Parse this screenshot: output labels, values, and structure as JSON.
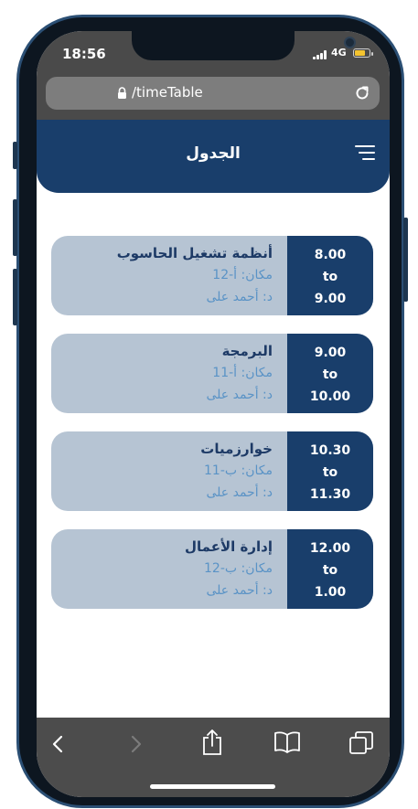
{
  "status_bar": {
    "time": "18:56",
    "network": "4G",
    "icons": [
      "signal-bars-icon",
      "battery-icon"
    ]
  },
  "browser": {
    "url": "/timeTable",
    "icons": [
      "lock-icon",
      "reload-icon"
    ]
  },
  "header": {
    "title": "الجدول",
    "menu_icon": "hamburger-menu-icon"
  },
  "schedule": [
    {
      "start": "8.00",
      "separator": "to",
      "end": "9.00",
      "course": "أنظمة تشغيل الحاسوب",
      "room": "مكان: أ-12",
      "teacher": "د: أحمد على"
    },
    {
      "start": "9.00",
      "separator": "to",
      "end": "10.00",
      "course": "البرمجة",
      "room": "مكان: أ-11",
      "teacher": "د: أحمد على"
    },
    {
      "start": "10.30",
      "separator": "to",
      "end": "11.30",
      "course": "خوارزميات",
      "room": "مكان: ب-11",
      "teacher": "د: أحمد على"
    },
    {
      "start": "12.00",
      "separator": "to",
      "end": "1.00",
      "course": "إدارة الأعمال",
      "room": "مكان: ب-12",
      "teacher": "د: أحمد على"
    }
  ],
  "toolbar": {
    "icons": [
      "back-icon",
      "forward-icon",
      "share-icon",
      "bookmarks-icon",
      "tabs-icon"
    ]
  },
  "colors": {
    "primary": "#193e6b",
    "card_bg": "#b6c4d3",
    "course_text": "#1d3a66",
    "detail_text": "#5a93c6"
  }
}
